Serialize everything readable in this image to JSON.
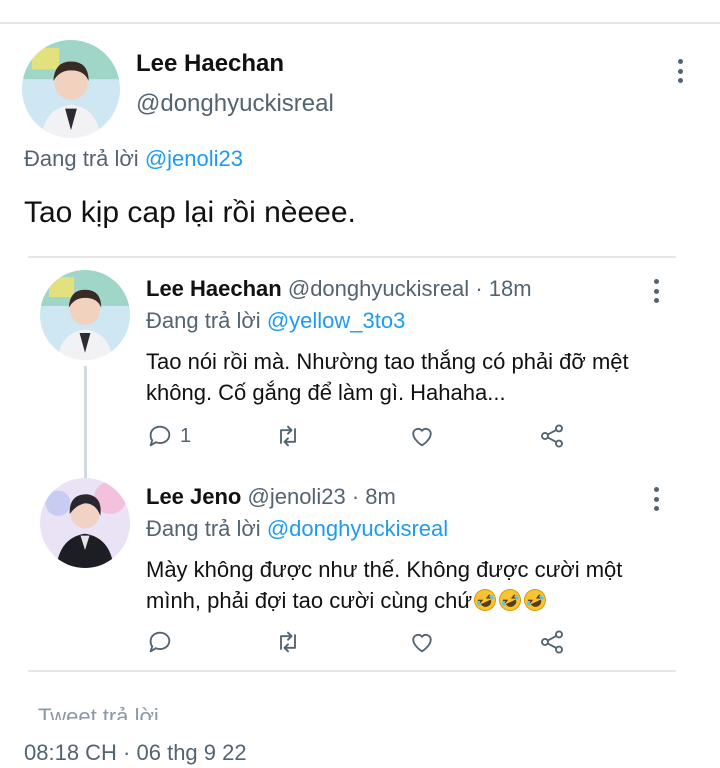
{
  "main_tweet": {
    "author_name": "Lee Haechan",
    "author_handle": "@donghyuckisreal",
    "replying_prefix": "Đang trả lời",
    "replying_to": "@jenoli23",
    "text": "Tao kịp cap lại rồi nèeee."
  },
  "replies": [
    {
      "author_name": "Lee Haechan",
      "author_handle": "@donghyuckisreal",
      "time": "· 18m",
      "replying_prefix": "Đang trả lời",
      "replying_to": "@yellow_3to3",
      "text": "Tao nói rồi mà. Nhường tao thắng có phải đỡ mệt không. Cố gắng để làm gì. Hahaha...",
      "reply_count": "1"
    },
    {
      "author_name": "Lee Jeno",
      "author_handle": "@jenoli23",
      "time": "· 8m",
      "replying_prefix": "Đang trả lời",
      "replying_to": "@donghyuckisreal",
      "text": "Mày không được như thế. Không được cười một mình, phải đợi tao cười cùng chứ",
      "emoji": [
        "rolling-on-floor-laughing",
        "rolling-on-floor-laughing",
        "rolling-on-floor-laughing"
      ]
    }
  ],
  "reply_box": {
    "placeholder": "Tweet trả lời"
  },
  "timestamp": "08:18 CH · 06 thg 9 22",
  "icons": {
    "more": "more-vertical-icon",
    "comment": "comment-icon",
    "retweet": "retweet-icon",
    "like": "heart-icon",
    "share": "share-icon"
  },
  "colors": {
    "link": "#1d9bf0",
    "secondary": "#536471",
    "text": "#0f1419"
  }
}
